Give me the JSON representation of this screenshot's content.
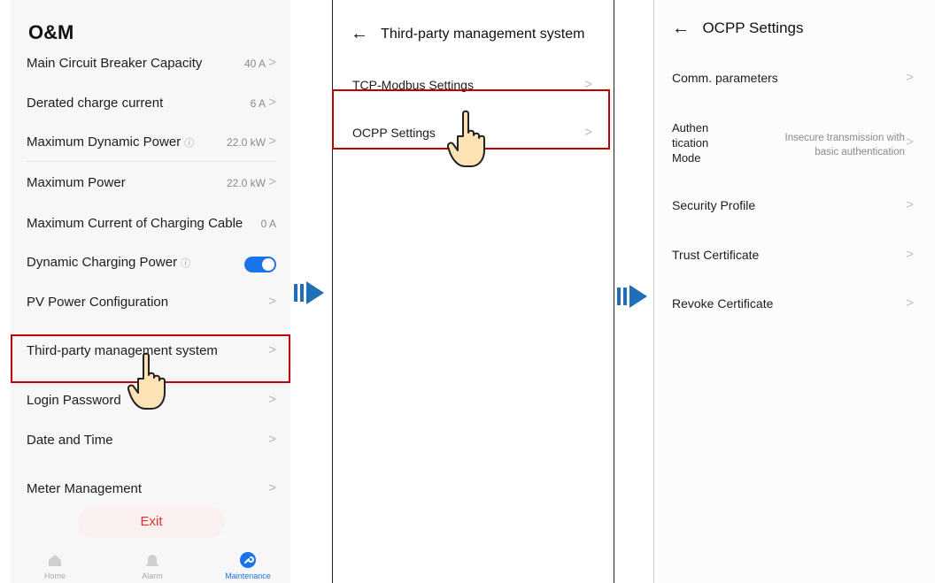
{
  "panel1": {
    "title": "O&M",
    "items": [
      {
        "label": "Main Circuit Breaker Capacity",
        "value": "40 A",
        "chevron": ">"
      },
      {
        "label": "Derated charge current",
        "value": "6 A",
        "chevron": ">"
      },
      {
        "label": "Maximum Dynamic Power",
        "info": "ⓘ",
        "value": "22.0 kW",
        "chevron": ">"
      },
      {
        "label": "Maximum Power",
        "value": "22.0 kW",
        "chevron": ">"
      },
      {
        "label": "Maximum Current of Charging Cable",
        "value": "0 A"
      },
      {
        "label": "Dynamic Charging Power",
        "info": "ⓘ",
        "toggle_on": true
      },
      {
        "label": "PV Power Configuration",
        "chevron": ">"
      },
      {
        "label": "Third-party management system",
        "chevron": ">"
      },
      {
        "label": "Login Password",
        "chevron": ">"
      },
      {
        "label": "Date and Time",
        "chevron": ">"
      },
      {
        "label": "Meter Management",
        "chevron": ">"
      }
    ],
    "exit_label": "Exit",
    "tabs": [
      {
        "label": "Home",
        "icon": "home-icon",
        "active": false
      },
      {
        "label": "Alarm",
        "icon": "alarm-icon",
        "active": false
      },
      {
        "label": "Maintenance",
        "icon": "wrench-icon",
        "active": true
      }
    ]
  },
  "panel2": {
    "back_arrow": "←",
    "title": "Third-party management system",
    "items": [
      {
        "label": "TCP-Modbus Settings",
        "chevron": ">"
      },
      {
        "label": "OCPP Settings",
        "chevron": ">"
      }
    ]
  },
  "panel3": {
    "back_arrow": "←",
    "title": "OCPP Settings",
    "items": [
      {
        "label": "Comm. parameters",
        "chevron": ">"
      },
      {
        "label_lines": [
          "Authen",
          "tication",
          "Mode"
        ],
        "value_lines": [
          "Insecure transmission with",
          "basic authentication"
        ],
        "chevron": ">"
      },
      {
        "label": "Security Profile",
        "chevron": ">"
      },
      {
        "label": "Trust Certificate",
        "chevron": ">"
      },
      {
        "label": "Revoke Certificate",
        "chevron": ">"
      }
    ]
  },
  "colors": {
    "accent": "#1a73e8",
    "highlight": "#c00000",
    "exit_text": "#e03030",
    "flow_arrow": "#1f6fb8"
  },
  "icons": {
    "flow_arrow": "next-step-arrow-icon",
    "pointer": "hand-pointer-icon"
  }
}
